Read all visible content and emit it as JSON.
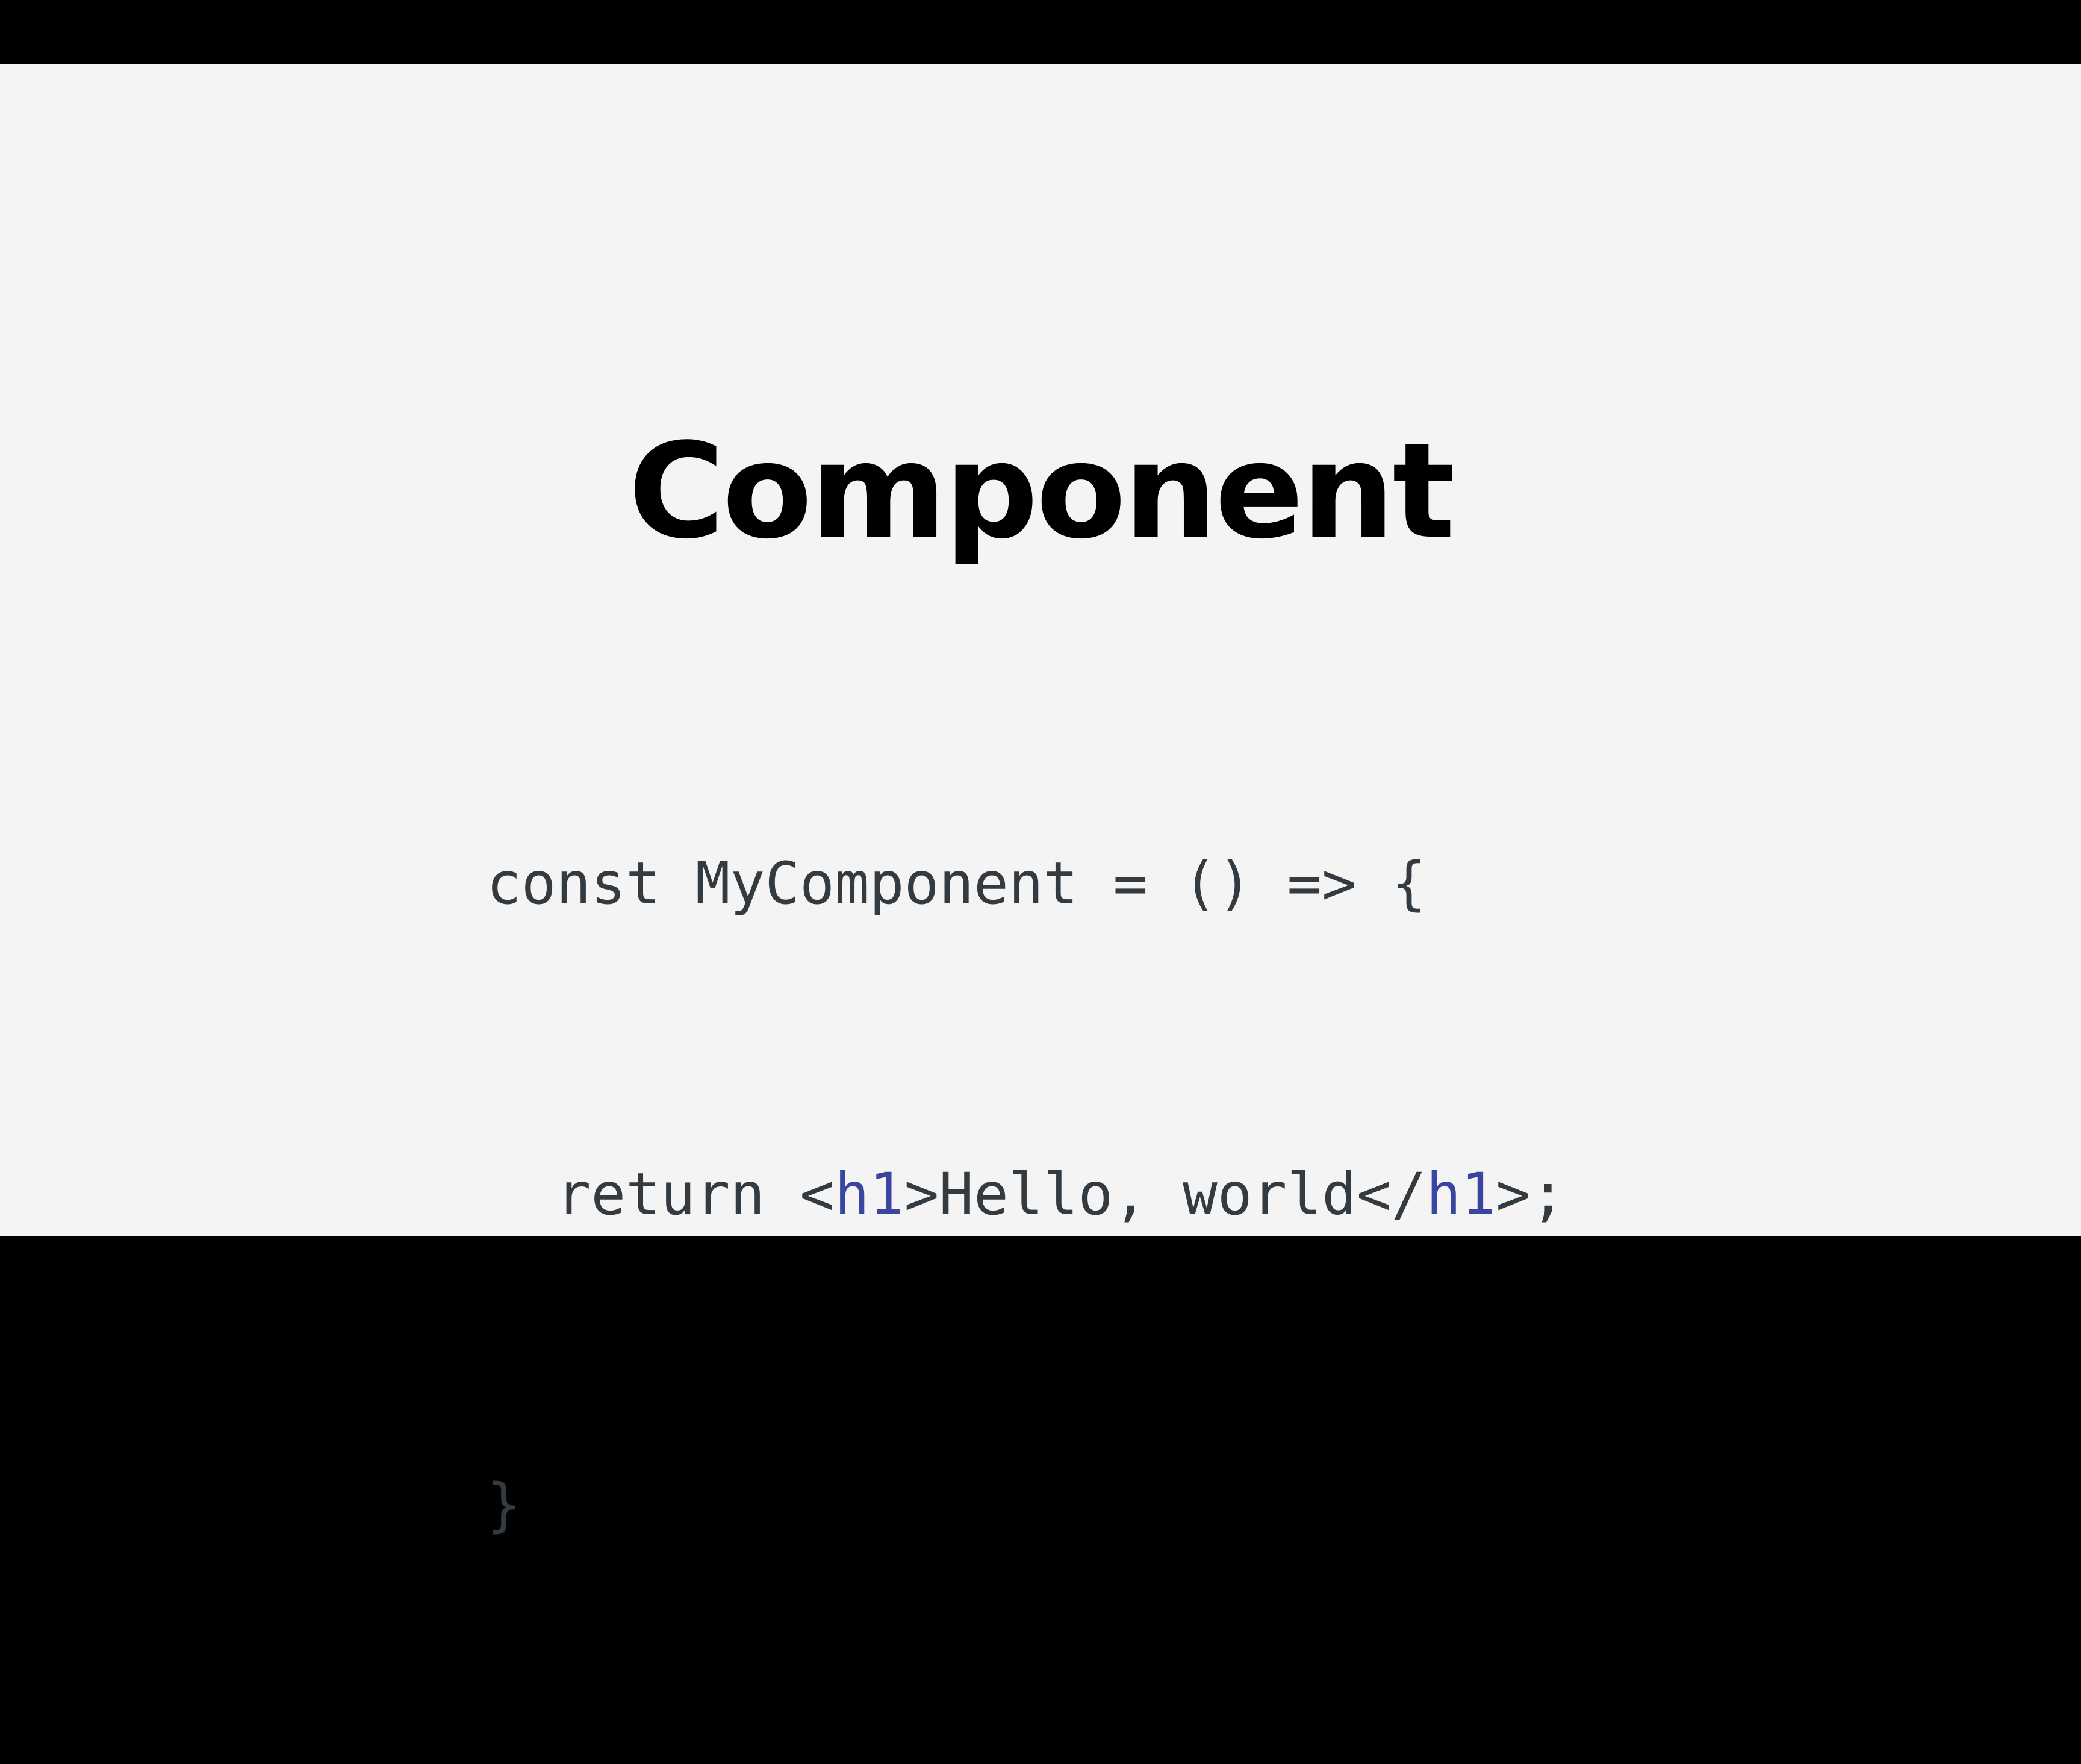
{
  "slide": {
    "title": "Component",
    "code": {
      "line1": "const MyComponent = () => {",
      "line2": {
        "indent": "  ",
        "before": "return <",
        "tag_open": "h1",
        "middle": ">Hello, world</",
        "tag_close": "h1",
        "after": ">;"
      },
      "line3": "}"
    }
  },
  "colors": {
    "background": "#f4f4f4",
    "letterbox": "#000000",
    "title": "#000000",
    "code_text": "#333a40",
    "code_tag": "#3a45a0"
  }
}
